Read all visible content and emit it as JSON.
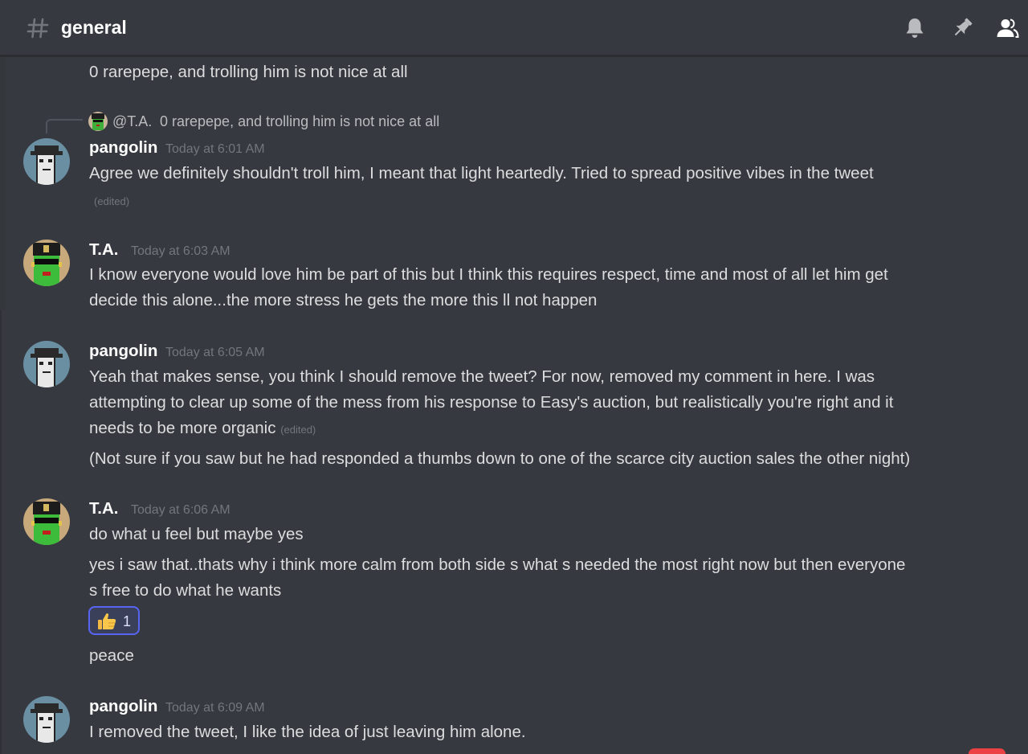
{
  "header": {
    "channel_name": "general",
    "icons": [
      "hash-icon",
      "bell-icon",
      "pin-icon",
      "members-icon"
    ]
  },
  "top_continuation": {
    "text": "0 rarepepe, and trolling him is not nice at all"
  },
  "reply": {
    "mention": "@T.A.",
    "text": "0 rarepepe, and trolling him is not nice at all"
  },
  "messages": [
    {
      "author": "pangolin",
      "timestamp": "Today at 6:01 AM",
      "lines": [
        "Agree we definitely shouldn't troll him, I meant that light heartedly. Tried to spread positive vibes in the tweet"
      ],
      "edited": "(edited)"
    },
    {
      "author": "T.A.",
      "timestamp": "Today at 6:03 AM",
      "lines": [
        "I know everyone would love him be part of this but I think this requires respect, time and most of all let him get",
        "decide this alone...the more stress he gets the more this ll not happen"
      ]
    },
    {
      "author": "pangolin",
      "timestamp": "Today at 6:05 AM",
      "lines": [
        "Yeah that makes sense, you think I should remove the tweet? For now, removed my comment in here. I was",
        "attempting to clear up some of the mess from his response to Easy's auction, but realistically you're right and it",
        "needs to be more organic"
      ],
      "edited": "(edited)",
      "followup": "(Not sure if you saw but he had responded a thumbs down to one of the scarce city auction sales the other night)"
    },
    {
      "author": "T.A.",
      "timestamp": "Today at 6:06 AM",
      "lines": [
        "do what u feel but maybe yes"
      ],
      "followup_lines": [
        "yes i saw that..thats why i think more calm from both side s what s needed the most right now but then everyone",
        "s free to do what he wants"
      ],
      "reaction": {
        "emoji": "thumbs-up-icon",
        "count": "1"
      },
      "final": "peace"
    },
    {
      "author": "pangolin",
      "timestamp": "Today at 6:09 AM",
      "lines": [
        "I removed the tweet, I like the idea of just leaving him alone."
      ]
    }
  ],
  "colors": {
    "background": "#36393f",
    "text": "#dcddde",
    "username": "#ffffff",
    "timestamp": "#72767d",
    "reaction_border": "#5865f2",
    "reaction_bg": "#3b405a"
  }
}
